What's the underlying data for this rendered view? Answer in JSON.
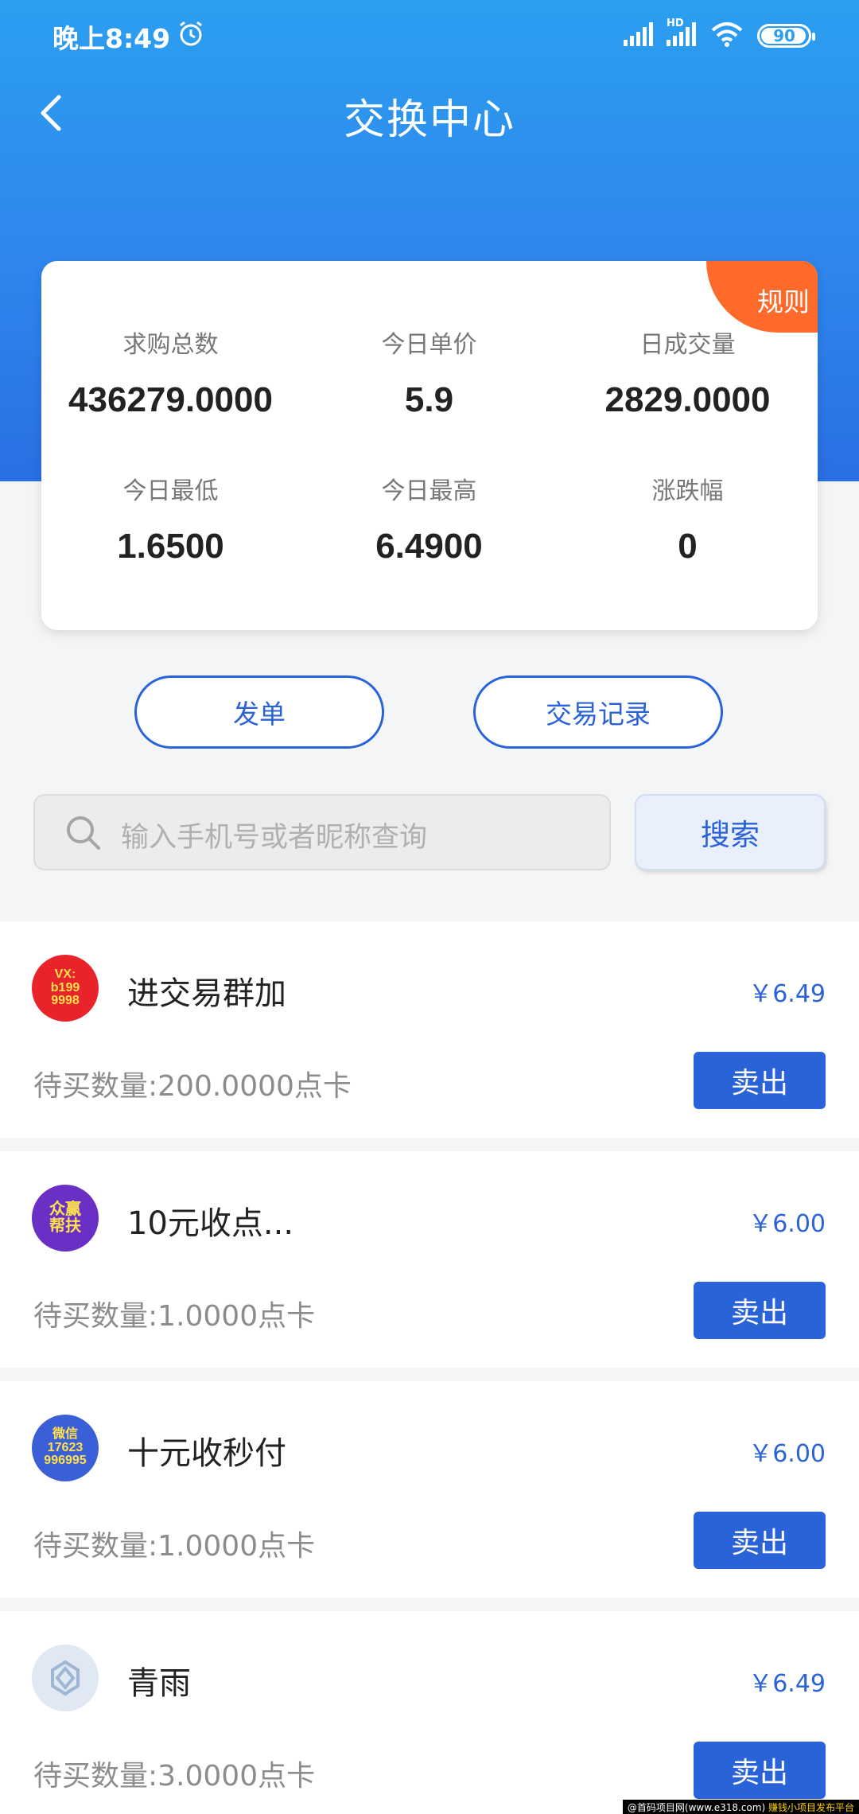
{
  "status": {
    "time": "晚上8:49",
    "battery": "90",
    "hd_label": "HD"
  },
  "header": {
    "title": "交换中心"
  },
  "stats": {
    "rules_label": "规则",
    "items": [
      {
        "label": "求购总数",
        "value": "436279.0000"
      },
      {
        "label": "今日单价",
        "value": "5.9"
      },
      {
        "label": "日成交量",
        "value": "2829.0000"
      },
      {
        "label": "今日最低",
        "value": "1.6500"
      },
      {
        "label": "今日最高",
        "value": "6.4900"
      },
      {
        "label": "涨跌幅",
        "value": "0"
      }
    ]
  },
  "actions": {
    "post_order": "发单",
    "trade_records": "交易记录"
  },
  "search": {
    "placeholder": "输入手机号或者昵称查询",
    "button": "搜索"
  },
  "list": [
    {
      "name": "进交易群加",
      "price": "￥6.49",
      "qty": "待买数量:200.0000点卡",
      "sell": "卖出",
      "avatar_lines": [
        "VX:",
        "b199",
        "9998"
      ],
      "avatar_color": "#e8232a"
    },
    {
      "name": "10元收点...",
      "price": "￥6.00",
      "qty": "待买数量:1.0000点卡",
      "sell": "卖出",
      "avatar_lines": [
        "众赢",
        "帮扶"
      ],
      "avatar_color": "#6a2fc4"
    },
    {
      "name": "十元收秒付",
      "price": "￥6.00",
      "qty": "待买数量:1.0000点卡",
      "sell": "卖出",
      "avatar_lines": [
        "微信",
        "17623",
        "996995"
      ],
      "avatar_color": "#3b5fd6"
    },
    {
      "name": "青雨",
      "price": "￥6.49",
      "qty": "待买数量:3.0000点卡",
      "sell": "卖出",
      "avatar_lines": [],
      "avatar_color": "#dfe8f3"
    }
  ],
  "watermark": {
    "left": "@首码项目网(www.e318.com)",
    "right": "赚钱小项目发布平台"
  }
}
